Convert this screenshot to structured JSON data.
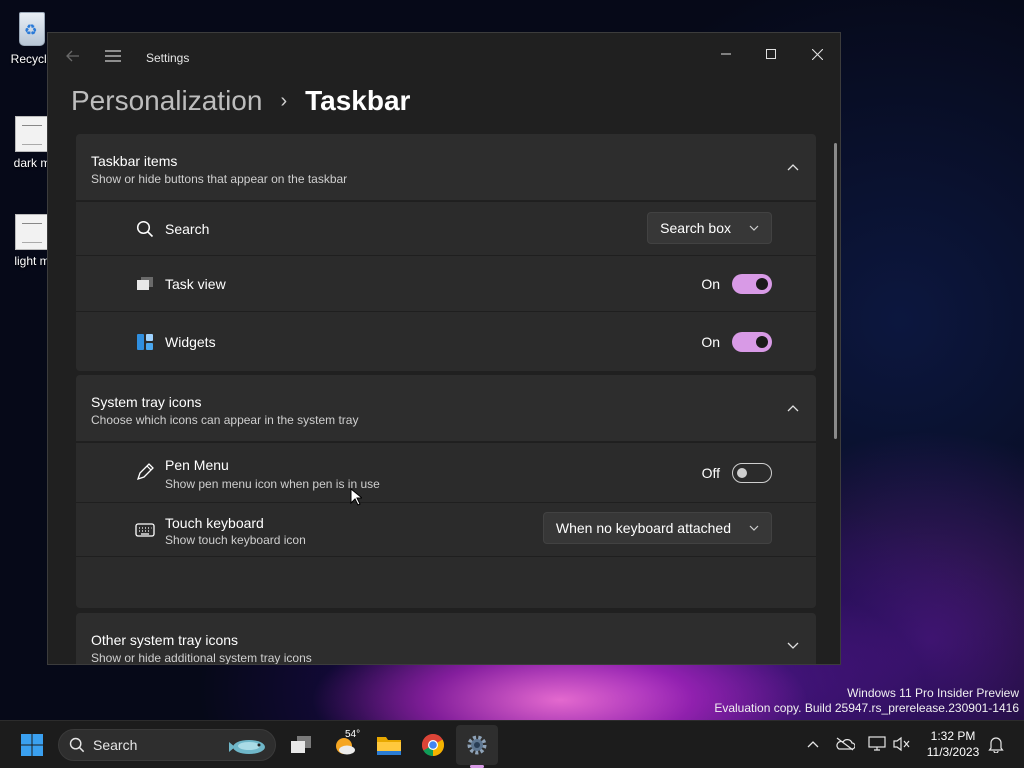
{
  "desktop": {
    "icons": [
      {
        "label": "Recycle"
      },
      {
        "label": "dark m"
      },
      {
        "label": "light m"
      }
    ]
  },
  "window": {
    "app_title": "Settings",
    "breadcrumb": {
      "parent": "Personalization",
      "separator": "›",
      "current": "Taskbar"
    },
    "sections": [
      {
        "title": "Taskbar items",
        "description": "Show or hide buttons that appear on the taskbar",
        "expanded": true,
        "rows": [
          {
            "icon": "search-icon",
            "label": "Search",
            "control": "dropdown",
            "value": "Search box"
          },
          {
            "icon": "task-view-icon",
            "label": "Task view",
            "control": "toggle",
            "state": "On"
          },
          {
            "icon": "widgets-icon",
            "label": "Widgets",
            "control": "toggle",
            "state": "On"
          }
        ]
      },
      {
        "title": "System tray icons",
        "description": "Choose which icons can appear in the system tray",
        "expanded": true,
        "rows": [
          {
            "icon": "pen-icon",
            "label": "Pen Menu",
            "sublabel": "Show pen menu icon when pen is in use",
            "control": "toggle",
            "state": "Off"
          },
          {
            "icon": "keyboard-icon",
            "label": "Touch keyboard",
            "sublabel": "Show touch keyboard icon",
            "control": "dropdown",
            "value": "When no keyboard attached"
          }
        ]
      },
      {
        "title": "Other system tray icons",
        "description": "Show or hide additional system tray icons",
        "expanded": false
      }
    ],
    "colors": {
      "accent": "#d89ae6",
      "background": "#202020",
      "card": "#2b2b2b"
    }
  },
  "watermark": {
    "line1": "Windows 11 Pro Insider Preview",
    "line2": "Evaluation copy. Build 25947.rs_prerelease.230901-1416"
  },
  "taskbar": {
    "search_placeholder": "Search",
    "weather_temp": "54°",
    "apps": [
      "start-icon",
      "search-box",
      "task-view-icon",
      "weather-icon",
      "file-explorer-icon",
      "chrome-icon",
      "settings-icon"
    ],
    "active_app": "settings-icon",
    "tray_icons": [
      "chevron-up-icon",
      "onedrive-icon",
      "network-icon",
      "volume-muted-icon",
      "notification-icon"
    ],
    "clock": {
      "time": "1:32 PM",
      "date": "11/3/2023"
    }
  }
}
